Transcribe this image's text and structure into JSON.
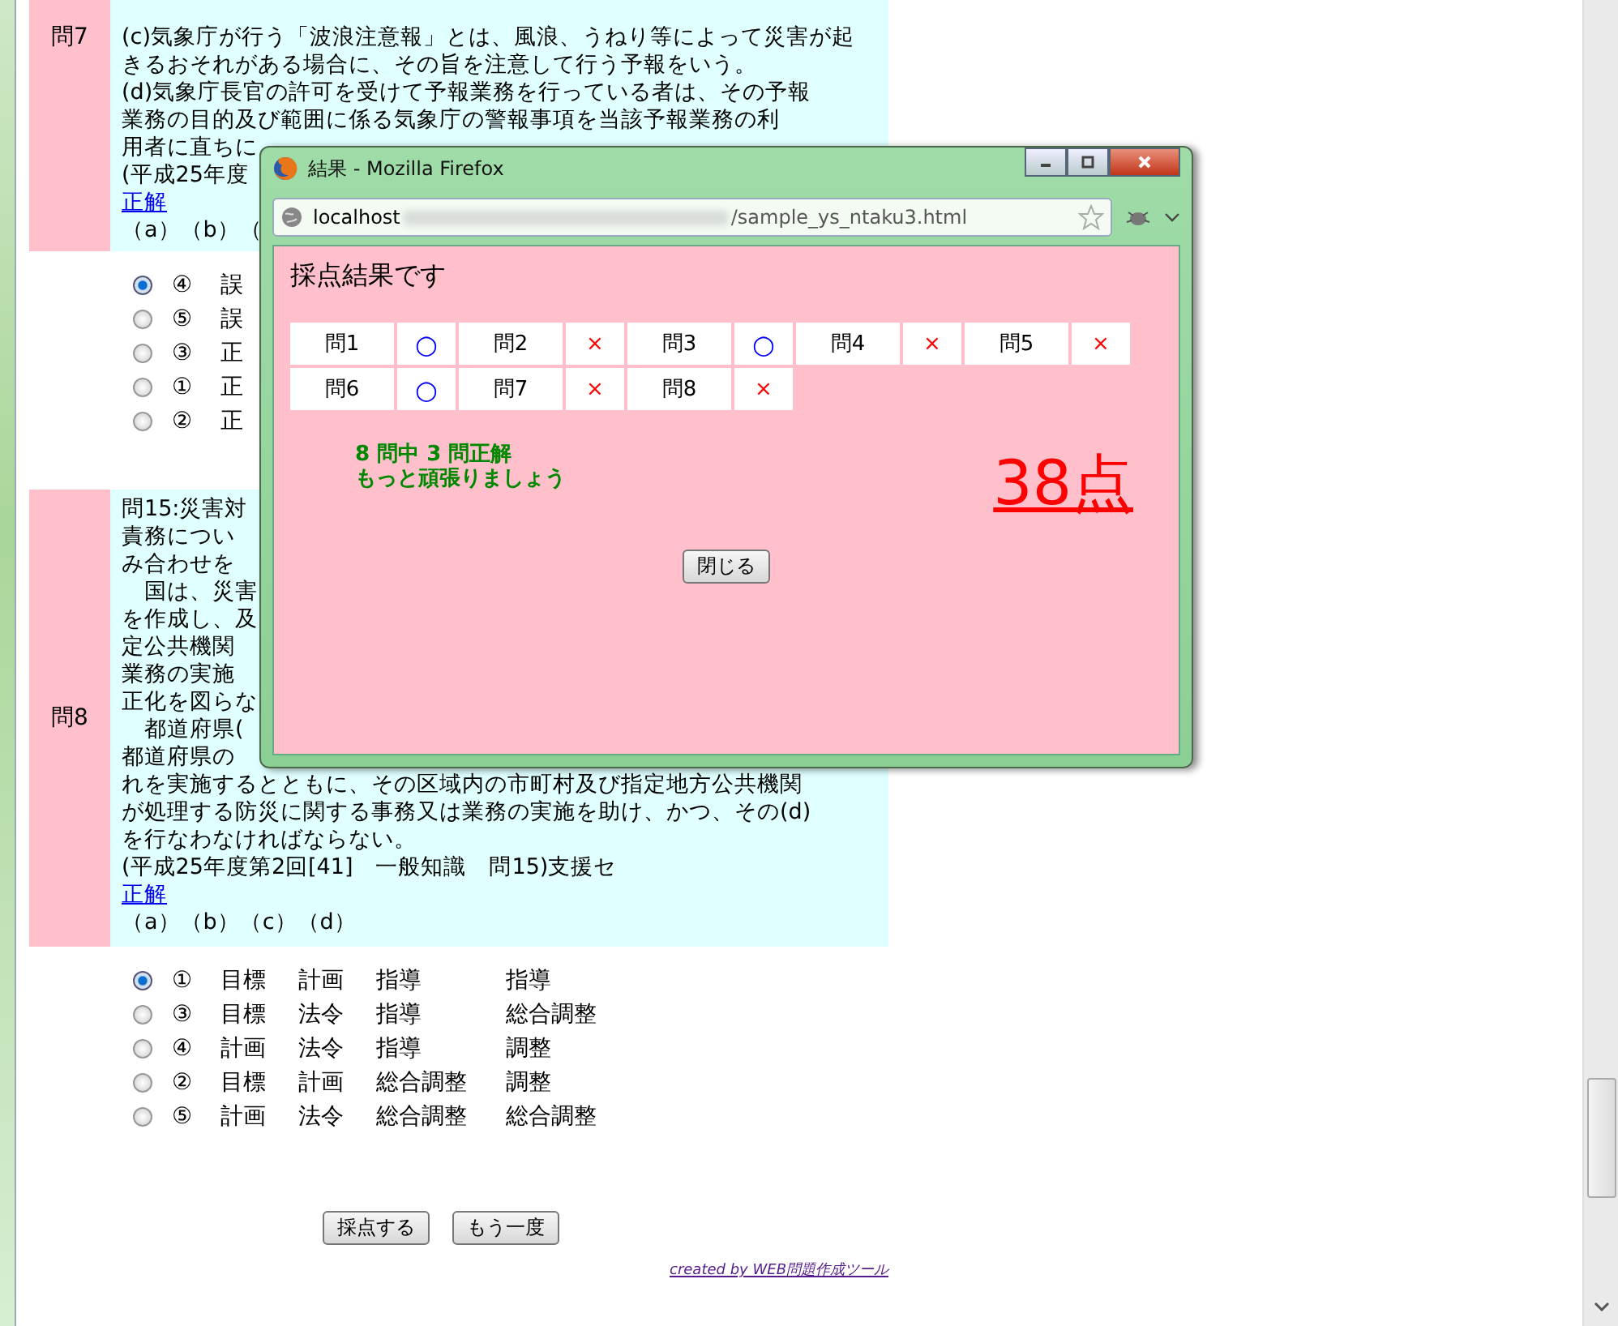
{
  "questions": [
    {
      "label": "問7",
      "lines": [
        "(c)気象庁が行う「波浪注意報」とは、風浪、うねり等によって災害が起",
        "きるおそれがある場合に、その旨を注意して行う予報をいう。",
        "(d)気象庁長官の許可を受けて予報業務を行っている者は、その予報",
        "業務の目的及び範囲に係る気象庁の警報事項を当該予報業務の利",
        "用者に直ちに",
        "(平成25年度"
      ],
      "answer_link": "正解",
      "answer": "（a）（b）（",
      "options": [
        {
          "parts": [
            "④",
            "誤"
          ],
          "selected": true
        },
        {
          "parts": [
            "⑤",
            "誤"
          ],
          "selected": false
        },
        {
          "parts": [
            "③",
            "正"
          ],
          "selected": false
        },
        {
          "parts": [
            "①",
            "正"
          ],
          "selected": false
        },
        {
          "parts": [
            "②",
            "正"
          ],
          "selected": false
        }
      ]
    },
    {
      "label": "問8",
      "lines": [
        "問15:災害対",
        "責務につい",
        "み合わせを",
        "　国は、災害",
        "を作成し、及",
        "定公共機関",
        "業務の実施",
        "正化を図らな",
        "　都道府県(",
        "都道府県の",
        "れを実施するとともに、その区域内の市町村及び指定地方公共機関",
        "が処理する防災に関する事務又は業務の実施を助け、かつ、その(d)",
        "を行なわなければならない。",
        "(平成25年度第2回[41]　一般知識　問15)支援セ"
      ],
      "answer_link": "正解",
      "answer": "（a）（b）（c）（d）",
      "options": [
        {
          "parts": [
            "①",
            "目標",
            "計画",
            "指導",
            "指導"
          ],
          "selected": true
        },
        {
          "parts": [
            "③",
            "目標",
            "法令",
            "指導",
            "総合調整"
          ],
          "selected": false
        },
        {
          "parts": [
            "④",
            "計画",
            "法令",
            "指導",
            "調整"
          ],
          "selected": false
        },
        {
          "parts": [
            "②",
            "目標",
            "計画",
            "総合調整",
            "調整"
          ],
          "selected": false
        },
        {
          "parts": [
            "⑤",
            "計画",
            "法令",
            "総合調整",
            "総合調整"
          ],
          "selected": false
        }
      ]
    }
  ],
  "buttons": [
    "採点する",
    "もう一度"
  ],
  "credit_link": "created by WEB問題作成ツール",
  "popup": {
    "title": "結果 - Mozilla Firefox",
    "url_host": "localhost",
    "url_file": "/sample_ys_ntaku3.html",
    "heading": "採点結果です",
    "results": [
      {
        "label": "問1",
        "mark": "○",
        "correct": true
      },
      {
        "label": "問2",
        "mark": "×",
        "correct": false
      },
      {
        "label": "問3",
        "mark": "○",
        "correct": true
      },
      {
        "label": "問4",
        "mark": "×",
        "correct": false
      },
      {
        "label": "問5",
        "mark": "×",
        "correct": false
      },
      {
        "label": "問6",
        "mark": "○",
        "correct": true
      },
      {
        "label": "問7",
        "mark": "×",
        "correct": false
      },
      {
        "label": "問8",
        "mark": "×",
        "correct": false
      }
    ],
    "summary": "8 問中 3 問正解",
    "message": "もっと頑張りましょう",
    "score": "38点",
    "close_button": "閉じる"
  }
}
